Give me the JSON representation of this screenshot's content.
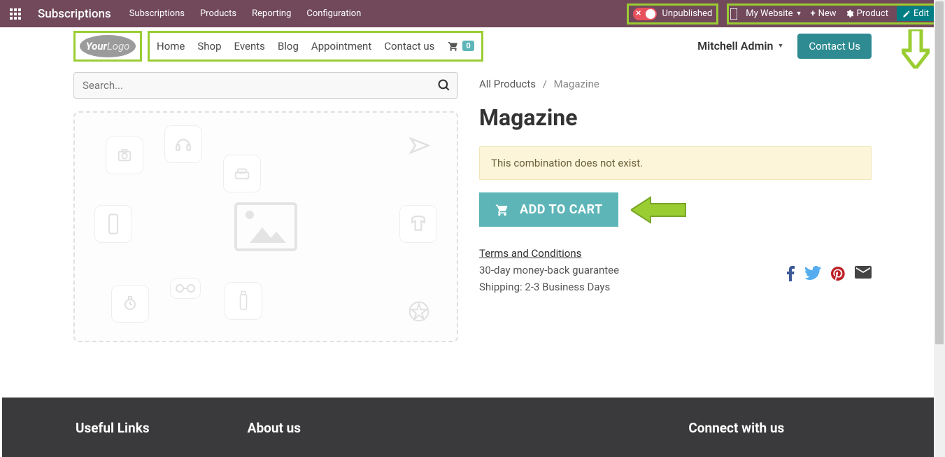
{
  "topbar": {
    "app_title": "Subscriptions",
    "menu": [
      "Subscriptions",
      "Products",
      "Reporting",
      "Configuration"
    ],
    "publish_label": "Unpublished",
    "website_label": "My Website",
    "new_label": "New",
    "product_label": "Product",
    "edit_label": "Edit"
  },
  "header": {
    "logo_your": "Your",
    "logo_logo": "Logo",
    "nav": [
      "Home",
      "Shop",
      "Events",
      "Blog",
      "Appointment",
      "Contact us"
    ],
    "cart_count": "0",
    "user_name": "Mitchell Admin",
    "contact_btn": "Contact Us"
  },
  "search": {
    "placeholder": "Search..."
  },
  "breadcrumb": {
    "root": "All Products",
    "current": "Magazine"
  },
  "product": {
    "title": "Magazine",
    "warning": "This combination does not exist.",
    "add_to_cart": "ADD TO CART",
    "terms_link": "Terms and Conditions",
    "guarantee": "30-day money-back guarantee",
    "shipping": "Shipping: 2-3 Business Days"
  },
  "footer": {
    "col1": "Useful Links",
    "col2": "About us",
    "col3": "Connect with us"
  },
  "colors": {
    "topbar_bg": "#71495a",
    "accent": "#5db5b8",
    "highlight": "#9acd32",
    "edit_bg": "#017e84"
  }
}
